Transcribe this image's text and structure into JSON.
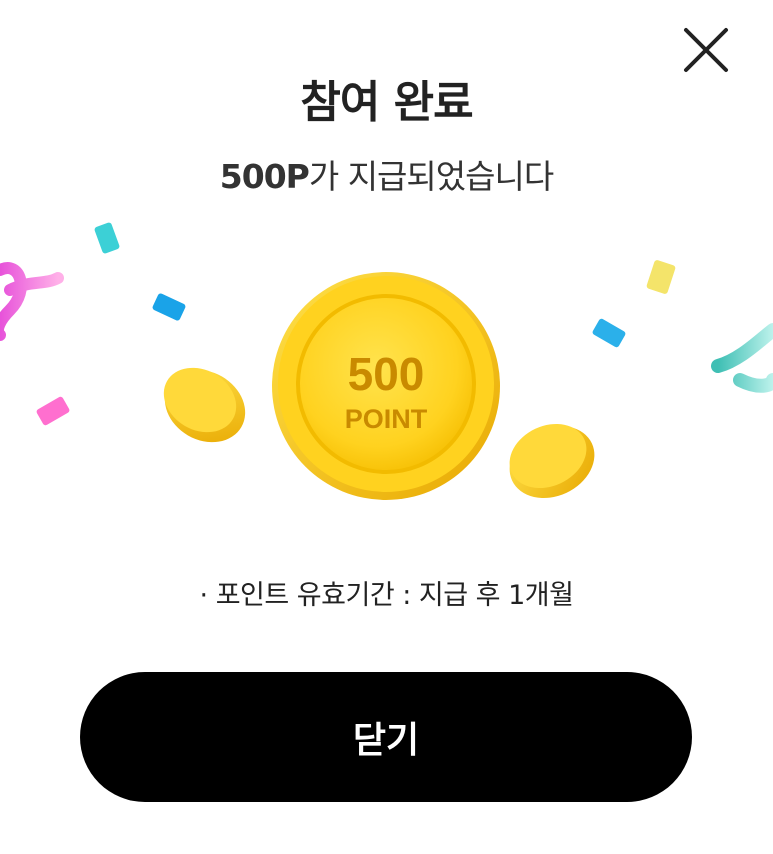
{
  "dialog": {
    "close_icon": "close-icon",
    "title": "참여 완료",
    "subtitle_amount": "500P",
    "subtitle_rest": "가 지급되었습니다",
    "coin": {
      "value": "500",
      "unit": "POINT",
      "color": "#ffd21f"
    },
    "info": "· 포인트 유효기간 : 지급 후 1개월",
    "close_button_label": "닫기"
  }
}
